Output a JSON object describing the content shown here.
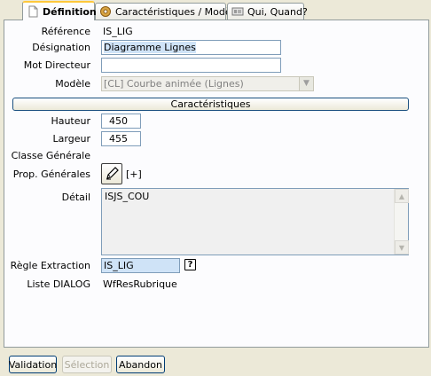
{
  "tabs": [
    {
      "label": "Définition",
      "icon": "document-icon"
    },
    {
      "label": "Caractéristiques / Modèle",
      "icon": "gear-icon"
    },
    {
      "label": "Qui, Quand?",
      "icon": "id-card-icon"
    }
  ],
  "form": {
    "reference_label": "Référence",
    "reference_value": "IS_LIG",
    "designation_label": "Désignation",
    "designation_value": "Diagramme Lignes",
    "mot_directeur_label": "Mot Directeur",
    "mot_directeur_value": "",
    "modele_label": "Modèle",
    "modele_value": "[CL] Courbe animée (Lignes)",
    "caracteristiques_button": "Caractéristiques",
    "hauteur_label": "Hauteur",
    "hauteur_value": "450",
    "largeur_label": "Largeur",
    "largeur_value": "455",
    "classe_generale_label": "Classe Générale",
    "prop_generales_label": "Prop. Générales",
    "prop_generales_expand": "[+]",
    "detail_label": "Détail",
    "detail_value": "ISJS_COU",
    "regle_extraction_label": "Règle Extraction",
    "regle_extraction_value": "IS_LIG",
    "help_button": "?",
    "liste_dialog_label": "Liste DIALOG",
    "liste_dialog_value": "WfResRubrique"
  },
  "footer": {
    "validation": "Validation",
    "selection": "Sélection",
    "abandon": "Abandon"
  },
  "colors": {
    "window_bg": "#ece9d8",
    "panel_bg": "#fcfcfe",
    "field_border": "#7f9db9",
    "selection_bg": "#cfe3f7",
    "tab_highlight": "#ffc83c"
  }
}
